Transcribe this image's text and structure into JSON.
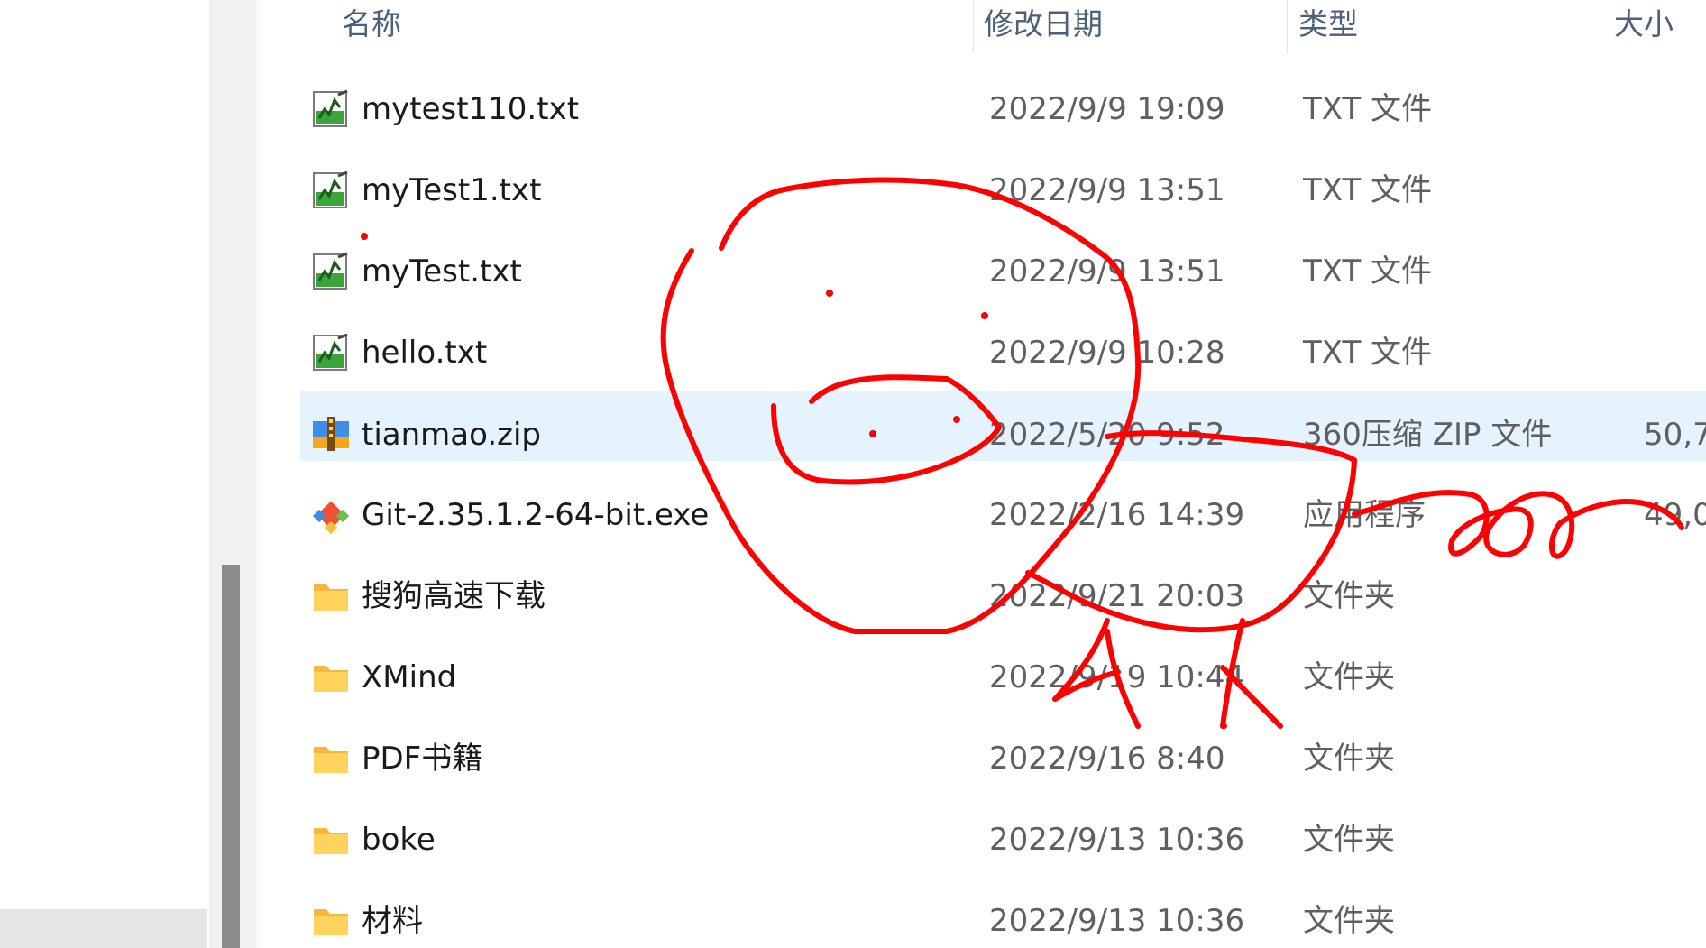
{
  "columns": {
    "name": "名称",
    "date": "修改日期",
    "type": "类型",
    "size": "大小"
  },
  "files": [
    {
      "name": "mytest110.txt",
      "date": "2022/9/9 19:09",
      "type": "TXT 文件",
      "size": "",
      "icon": "text-file-icon"
    },
    {
      "name": "myTest1.txt",
      "date": "2022/9/9 13:51",
      "type": "TXT 文件",
      "size": "",
      "icon": "text-file-icon"
    },
    {
      "name": "myTest.txt",
      "date": "2022/9/9 13:51",
      "type": "TXT 文件",
      "size": "",
      "icon": "text-file-icon"
    },
    {
      "name": "hello.txt",
      "date": "2022/9/9 10:28",
      "type": "TXT 文件",
      "size": "",
      "icon": "text-file-icon"
    },
    {
      "name": "tianmao.zip",
      "date": "2022/5/20 9:52",
      "type": "360压缩 ZIP 文件",
      "size": "50,7",
      "icon": "zip-archive-icon",
      "selected": true
    },
    {
      "name": "Git-2.35.1.2-64-bit.exe",
      "date": "2022/2/16 14:39",
      "type": "应用程序",
      "size": "49,0",
      "icon": "git-installer-icon"
    },
    {
      "name": "搜狗高速下载",
      "date": "2022/9/21 20:03",
      "type": "文件夹",
      "size": "",
      "icon": "folder-icon"
    },
    {
      "name": "XMind",
      "date": "2022/9/19 10:44",
      "type": "文件夹",
      "size": "",
      "icon": "folder-icon"
    },
    {
      "name": "PDF书籍",
      "date": "2022/9/16 8:40",
      "type": "文件夹",
      "size": "",
      "icon": "folder-icon"
    },
    {
      "name": "boke",
      "date": "2022/9/13 10:36",
      "type": "文件夹",
      "size": "",
      "icon": "folder-icon"
    },
    {
      "name": "材料",
      "date": "2022/9/13 10:36",
      "type": "文件夹",
      "size": "",
      "icon": "folder-icon"
    }
  ],
  "colors": {
    "header_text": "#4c607a",
    "selected_row": "#e5f3ff",
    "scribble": "#ff0000",
    "folder": "#ffd35c"
  }
}
